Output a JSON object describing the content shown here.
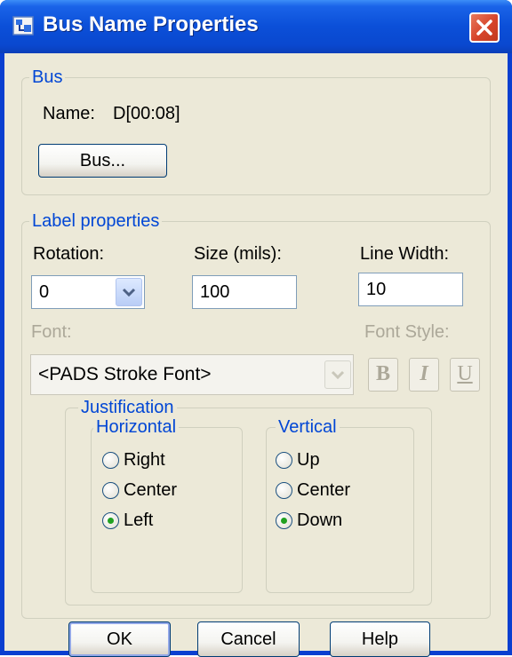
{
  "window": {
    "title": "Bus Name Properties"
  },
  "bus_group": {
    "legend": "Bus",
    "name_label": "Name:",
    "name_value": "D[00:08]",
    "bus_button": "Bus..."
  },
  "label_group": {
    "legend": "Label properties",
    "rotation_label": "Rotation:",
    "rotation_value": "0",
    "size_label": "Size (mils):",
    "size_value": "100",
    "line_width_label": "Line Width:",
    "line_width_value": "10",
    "font_label": "Font:",
    "font_value": "<PADS Stroke Font>",
    "font_style_label": "Font Style:",
    "font_style_buttons": {
      "bold": "B",
      "italic": "I",
      "underline": "U"
    }
  },
  "justification": {
    "legend": "Justification",
    "horizontal": {
      "legend": "Horizontal",
      "options": [
        "Right",
        "Center",
        "Left"
      ],
      "selected": "Left"
    },
    "vertical": {
      "legend": "Vertical",
      "options": [
        "Up",
        "Center",
        "Down"
      ],
      "selected": "Down"
    }
  },
  "buttons": {
    "ok": "OK",
    "cancel": "Cancel",
    "help": "Help"
  },
  "colors": {
    "titlebar": "#0a48cf",
    "dialog_bg": "#ece9d8",
    "group_legend": "#0046d5",
    "disabled_text": "#aca899",
    "radio_selected": "#21a121"
  }
}
